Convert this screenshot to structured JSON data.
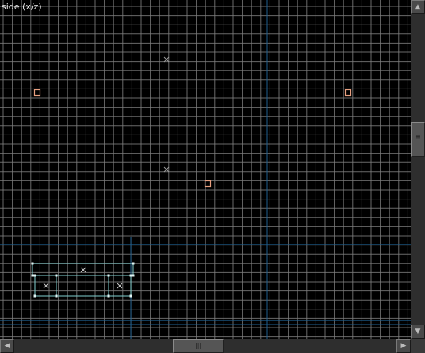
{
  "viewport": {
    "label": "side (x/z)",
    "colors": {
      "background": "#000000",
      "grid": "#7d7d7d",
      "axis": "#1f5f8f",
      "entity": "#e8a080",
      "selection": "#7fd0d0",
      "origin_marker": "#9a9a9a"
    }
  },
  "scrollbars": {
    "up_icon": "triangle-up-icon",
    "down_icon": "triangle-down-icon",
    "left_icon": "triangle-left-icon",
    "right_icon": "triangle-right-icon",
    "grip_icon": "grip-lines-icon"
  }
}
